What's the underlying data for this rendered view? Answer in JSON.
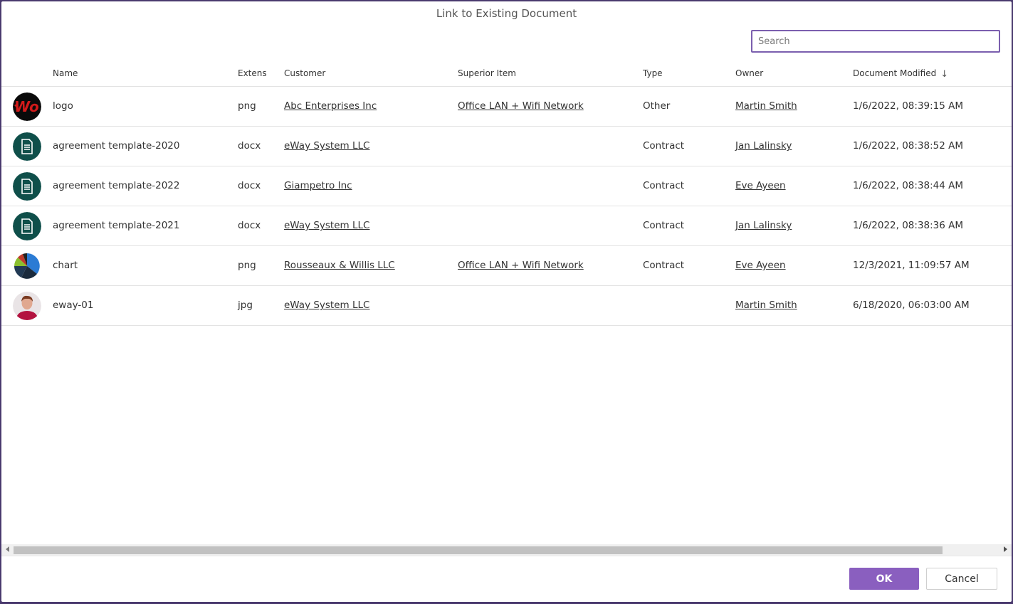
{
  "dialog": {
    "title": "Link to Existing Document",
    "search_placeholder": "Search",
    "ok_label": "OK",
    "cancel_label": "Cancel"
  },
  "columns": {
    "name": "Name",
    "ext": "Extens",
    "customer": "Customer",
    "superior": "Superior Item",
    "type": "Type",
    "owner": "Owner",
    "modified": "Document Modified"
  },
  "rows": [
    {
      "thumb": "logo-thumbnail",
      "name": "logo",
      "ext": "png",
      "customer": "Abc Enterprises Inc",
      "superior": "Office LAN + Wifi Network",
      "type": "Other",
      "owner": "Martin Smith",
      "modified": "1/6/2022, 08:39:15 AM"
    },
    {
      "thumb": "document-icon",
      "name": "agreement template-2020",
      "ext": "docx",
      "customer": "eWay System LLC",
      "superior": "",
      "type": "Contract",
      "owner": "Jan Lalinsky",
      "modified": "1/6/2022, 08:38:52 AM"
    },
    {
      "thumb": "document-icon",
      "name": "agreement template-2022",
      "ext": "docx",
      "customer": "Giampetro Inc",
      "superior": "",
      "type": "Contract",
      "owner": "Eve Ayeen",
      "modified": "1/6/2022, 08:38:44 AM"
    },
    {
      "thumb": "document-icon",
      "name": "agreement template-2021",
      "ext": "docx",
      "customer": "eWay System LLC",
      "superior": "",
      "type": "Contract",
      "owner": "Jan Lalinsky",
      "modified": "1/6/2022, 08:38:36 AM"
    },
    {
      "thumb": "pie-chart-thumbnail",
      "name": "chart",
      "ext": "png",
      "customer": "Rousseaux & Willis LLC",
      "superior": "Office LAN + Wifi Network",
      "type": "Contract",
      "owner": "Eve Ayeen",
      "modified": "12/3/2021, 11:09:57 AM"
    },
    {
      "thumb": "person-photo-thumbnail",
      "name": "eway-01",
      "ext": "jpg",
      "customer": "eWay System LLC",
      "superior": "",
      "type": "",
      "owner": "Martin Smith",
      "modified": "6/18/2020, 06:03:00 AM"
    }
  ],
  "colors": {
    "accent": "#8a5fbf",
    "doc_icon_bg": "#0f4f4a"
  }
}
